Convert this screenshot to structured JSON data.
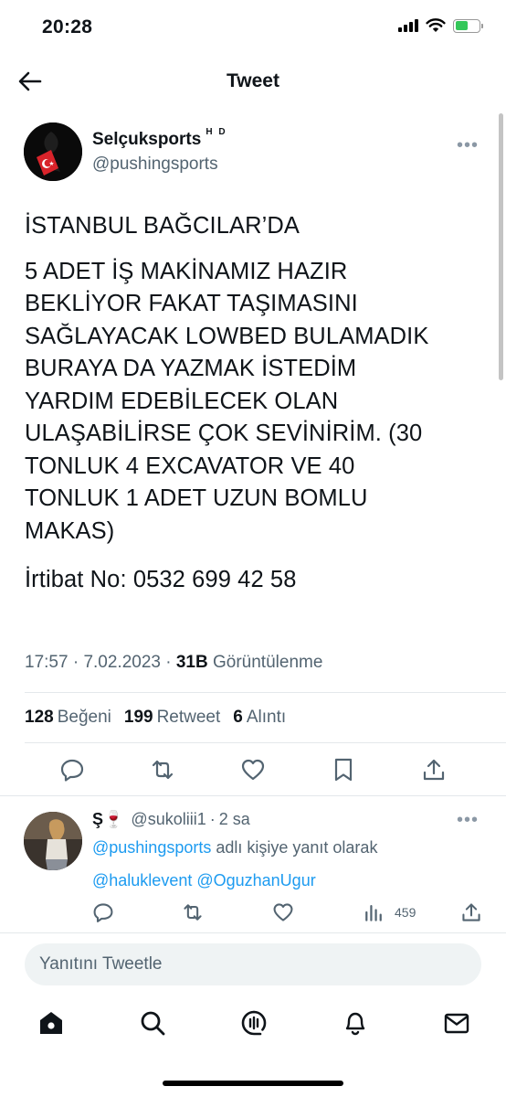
{
  "status_bar": {
    "time": "20:28",
    "icons": [
      "cellular-signal-icon",
      "wifi-icon",
      "battery-charging-icon"
    ],
    "battery_color": "#34c759"
  },
  "header": {
    "title": "Tweet",
    "back_icon": "back-arrow-icon"
  },
  "tweet": {
    "author_name": "Selçuksports",
    "author_badge": "H D",
    "author_handle": "@pushingsports",
    "more_icon": "more-horizontal-icon",
    "title_line": "İSTANBUL BAĞCILAR’DA",
    "body": "5 ADET İŞ MAKİNAMIZ HAZIR\nBEKLİYOR FAKAT TAŞIMASINI\nSAĞLAYACAK LOWBED BULAMADIK\nBURAYA DA YAZMAK İSTEDİM\nYARDIM EDEBİLECEK OLAN\nULAŞABİLİRSE ÇOK SEVİNİRİM. (30\nTONLUK 4 EXCAVATOR VE 40\nTONLUK 1 ADET UZUN BOMLU\nMAKAS)",
    "contact": "İrtibat No: 0532 699 42 58",
    "time": "17:57",
    "date": "7.02.2023",
    "sep": "·",
    "views_count": "31B",
    "views_label": "Görüntülenme",
    "stats": {
      "likes_count": "128",
      "likes_label": "Beğeni",
      "retweets_count": "199",
      "retweets_label": "Retweet",
      "quotes_count": "6",
      "quotes_label": "Alıntı"
    },
    "actions": [
      "reply-icon",
      "retweet-icon",
      "like-icon",
      "bookmark-icon",
      "share-icon"
    ],
    "accent_color": "#1d9bf0"
  },
  "reply": {
    "name": "Ş🍷",
    "handle": "@sukoliii1",
    "age": "2 sa",
    "context_mention": "@pushingsports",
    "context_text": "adlı kişiye yanıt olarak",
    "mention_1": "@haluklevent",
    "mention_2": "@OguzhanUgur",
    "views": "459"
  },
  "compose": {
    "placeholder": "Yanıtını Tweetle"
  },
  "bottom_nav": {
    "items": [
      "home-icon",
      "search-icon",
      "spaces-icon",
      "notifications-icon",
      "messages-icon"
    ]
  }
}
